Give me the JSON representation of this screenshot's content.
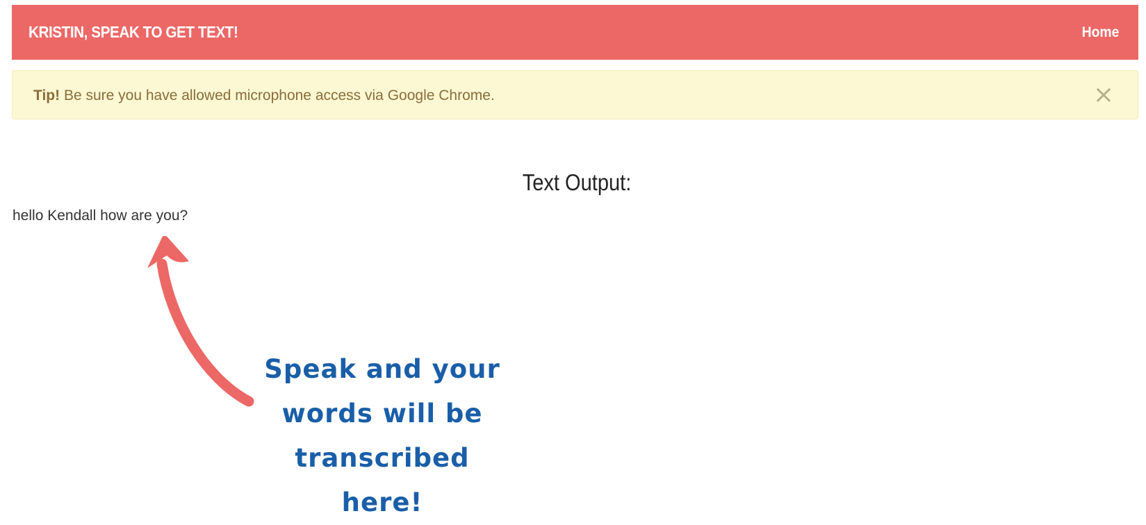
{
  "navbar": {
    "brand": "KRISTIN, SPEAK TO GET TEXT!",
    "home_link": "Home",
    "color": "#ec6866"
  },
  "alert": {
    "label": "Tip!",
    "message": " Be sure you have allowed microphone access via Google Chrome.",
    "close_icon": "×",
    "background": "#fcf8d3"
  },
  "output": {
    "title": "Text Output:",
    "text": "hello Kendall how are you?"
  },
  "annotation": {
    "line1": "Speak and your",
    "line2": "words will be",
    "line3": "transcribed here!",
    "color": "#1a5ea8",
    "arrow_color": "#ec6866"
  }
}
